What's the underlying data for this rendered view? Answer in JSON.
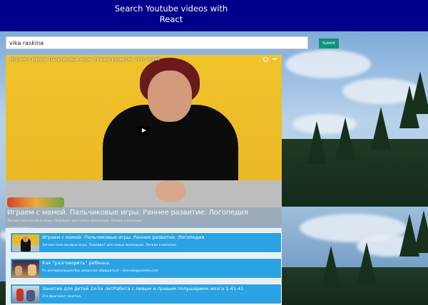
{
  "header": {
    "title_line1": "Search Youtube videos with",
    "title_line2": "React"
  },
  "search": {
    "value": "vika raskina",
    "submit_label": "Submit"
  },
  "main_video": {
    "overlay_title": "Играем с мамой. Пальчиковые игры. Раннее развитие. Логопедия",
    "title": "Играем с мамой. Пальчиковые игры. Раннее развитие. Логопедия",
    "description": "Легкие пальчиковые игры. Подойдет для самых маленьких. Легкие и веселые."
  },
  "video_list": [
    {
      "title": "Играем с мамой. Пальчиковые игры. Раннее развитие. Логопедия",
      "description": "Легкие пальчиковые игры. Подойдет для самых маленьких. Легкие и веселые."
    },
    {
      "title": "Как \"разговорить\" ребенка.",
      "description": "По интересующим Вас вопросам обращаться - vikarask@yandex.com"
    },
    {
      "title": "Занятие для детей 2х-5х летРабота с левым и правым полушарием мозга 1-41-41",
      "description": "Это фрагмент занятия."
    }
  ],
  "colors": {
    "header_bg": "#00008b",
    "submit_bg": "#13917f",
    "list_item_bg": "#2aa2e4"
  }
}
